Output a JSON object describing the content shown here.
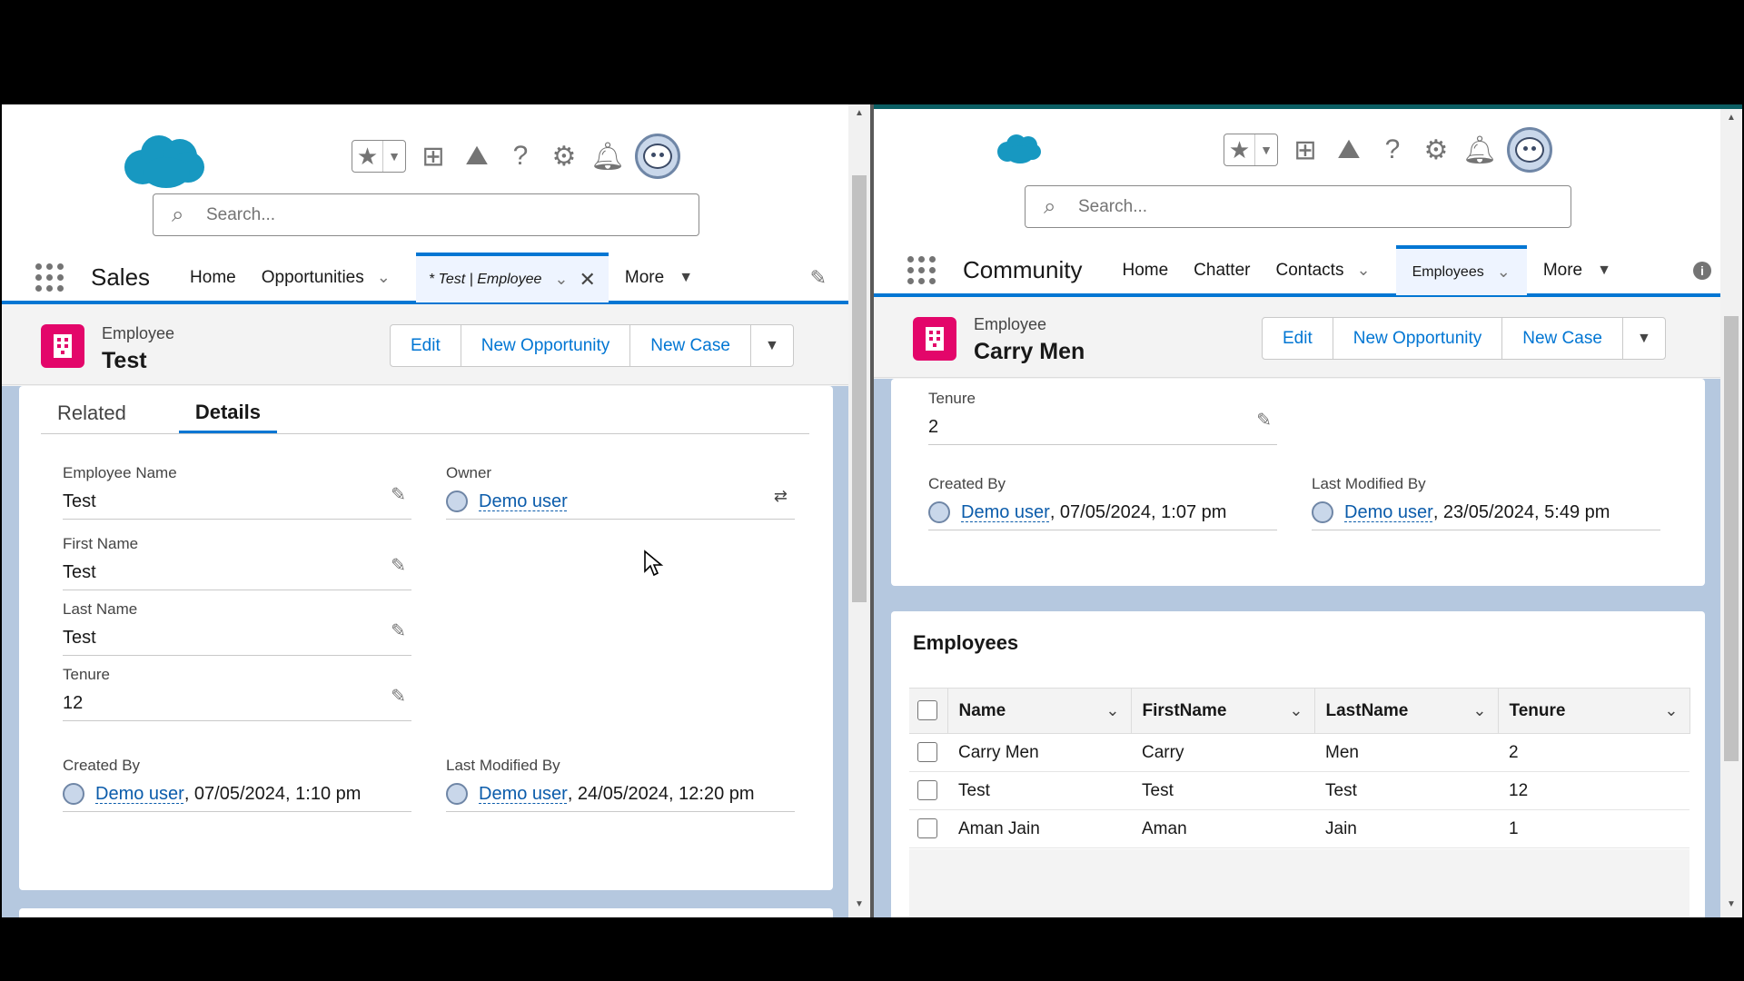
{
  "left": {
    "search_placeholder": "Search...",
    "app_name": "Sales",
    "nav": {
      "home": "Home",
      "opportunities": "Opportunities",
      "active_tab": "* Test | Employee",
      "more": "More"
    },
    "record": {
      "type_label": "Employee",
      "title": "Test"
    },
    "actions": {
      "edit": "Edit",
      "new_opportunity": "New Opportunity",
      "new_case": "New Case"
    },
    "tabs": {
      "related": "Related",
      "details": "Details"
    },
    "fields": {
      "employee_name": {
        "label": "Employee Name",
        "value": "Test"
      },
      "owner": {
        "label": "Owner",
        "value": "Demo user"
      },
      "first_name": {
        "label": "First Name",
        "value": "Test"
      },
      "last_name": {
        "label": "Last Name",
        "value": "Test"
      },
      "tenure": {
        "label": "Tenure",
        "value": "12"
      },
      "created_by": {
        "label": "Created By",
        "user": "Demo user",
        "date": ", 07/05/2024, 1:10 pm"
      },
      "last_modified_by": {
        "label": "Last Modified By",
        "user": "Demo user",
        "date": ", 24/05/2024, 12:20 pm"
      }
    }
  },
  "right": {
    "search_placeholder": "Search...",
    "app_name": "Community",
    "nav": {
      "home": "Home",
      "chatter": "Chatter",
      "contacts": "Contacts",
      "active_tab": "Employees",
      "more": "More"
    },
    "record": {
      "type_label": "Employee",
      "title": "Carry Men"
    },
    "actions": {
      "edit": "Edit",
      "new_opportunity": "New Opportunity",
      "new_case": "New Case"
    },
    "fields": {
      "tenure": {
        "label": "Tenure",
        "value": "2"
      },
      "created_by": {
        "label": "Created By",
        "user": "Demo user",
        "date": ", 07/05/2024, 1:07 pm"
      },
      "last_modified_by": {
        "label": "Last Modified By",
        "user": "Demo user",
        "date": ", 23/05/2024, 5:49 pm"
      }
    },
    "related": {
      "title": "Employees",
      "columns": [
        "Name",
        "FirstName",
        "LastName",
        "Tenure"
      ],
      "rows": [
        [
          "Carry Men",
          "Carry",
          "Men",
          "2"
        ],
        [
          "Test",
          "Test",
          "Test",
          "12"
        ],
        [
          "Aman Jain",
          "Aman",
          "Jain",
          "1"
        ]
      ]
    }
  },
  "colors": {
    "brand_blue": "#0176d3",
    "logo_blue": "#1798c1",
    "record_icon": "#e3066a",
    "link": "#0b5cab"
  },
  "icons": [
    "star-icon",
    "add-icon",
    "trailhead-icon",
    "help-icon",
    "gear-icon",
    "bell-icon",
    "search-icon",
    "waffle-icon",
    "pencil-icon",
    "close-icon",
    "info-icon",
    "building-icon"
  ]
}
